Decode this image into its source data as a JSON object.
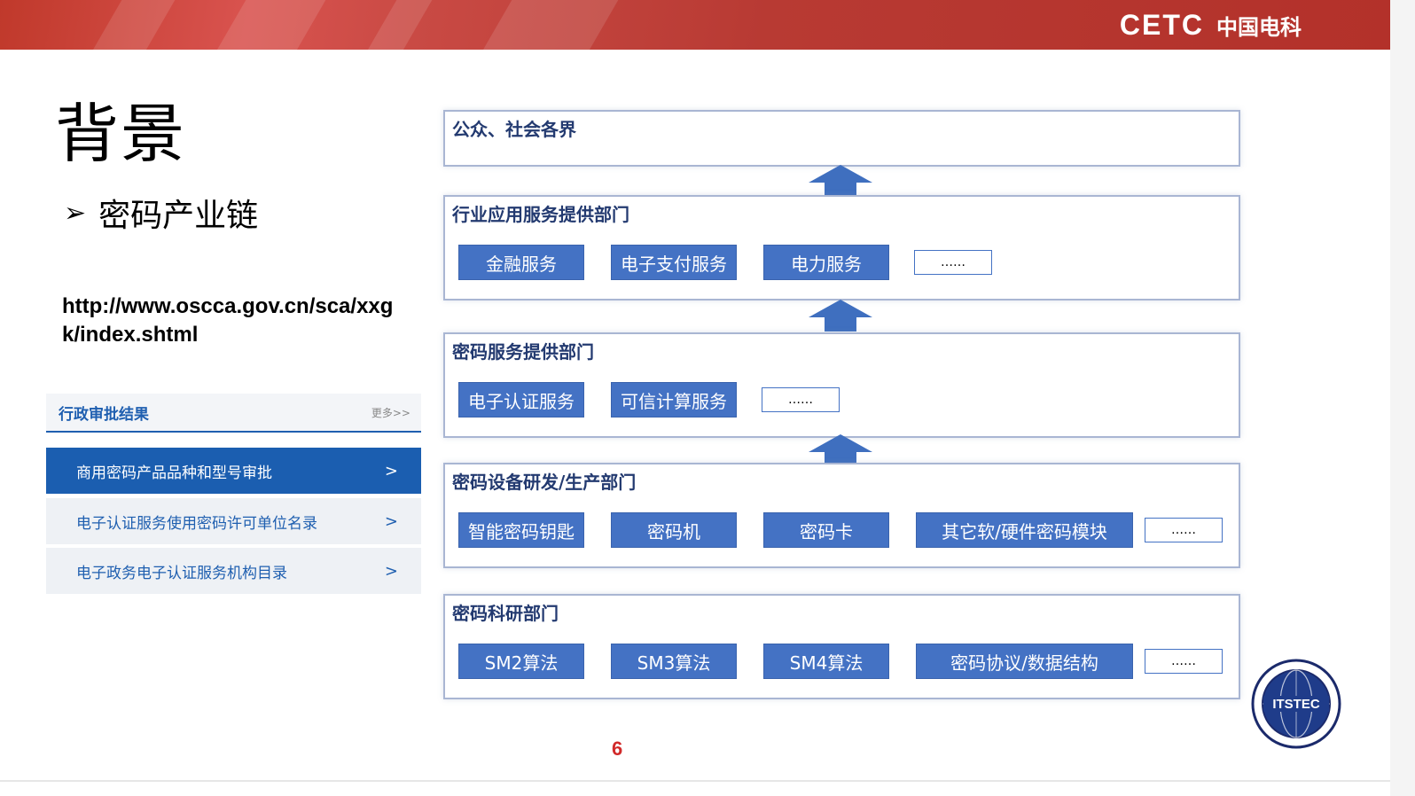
{
  "header": {
    "brand_latin": "CETC",
    "brand_cn": "中国电科"
  },
  "title": "背景",
  "bullet": {
    "symbol": "➢",
    "text": "密码产业链"
  },
  "url": "http://www.oscca.gov.cn/sca/xxgk/index.shtml",
  "panel": {
    "heading": "行政审批结果",
    "more": "更多>>",
    "items": [
      {
        "label": "商用密码产品品种和型号审批",
        "chevron": ">",
        "active": true
      },
      {
        "label": "电子认证服务使用密码许可单位名录",
        "chevron": ">",
        "active": false
      },
      {
        "label": "电子政务电子认证服务机构目录",
        "chevron": ">",
        "active": false
      }
    ]
  },
  "diagram": {
    "layers": [
      {
        "title": "公众、社会各界",
        "boxes": [],
        "ellipsis": ""
      },
      {
        "title": "行业应用服务提供部门",
        "boxes": [
          "金融服务",
          "电子支付服务",
          "电力服务"
        ],
        "ellipsis": "……"
      },
      {
        "title": "密码服务提供部门",
        "boxes": [
          "电子认证服务",
          "可信计算服务"
        ],
        "ellipsis": "……"
      },
      {
        "title": "密码设备研发/生产部门",
        "boxes": [
          "智能密码钥匙",
          "密码机",
          "密码卡",
          "其它软/硬件密码模块"
        ],
        "ellipsis": "……"
      },
      {
        "title": "密码科研部门",
        "boxes": [
          "SM2算法",
          "SM3算法",
          "SM4算法",
          "密码协议/数据结构"
        ],
        "ellipsis": "……"
      }
    ],
    "colors": {
      "box_fill": "#4472c4",
      "arrow": "#3f6fbf",
      "border": "#a9b6d3"
    }
  },
  "page_number": "6",
  "seal": {
    "text": "ITSTEC"
  }
}
